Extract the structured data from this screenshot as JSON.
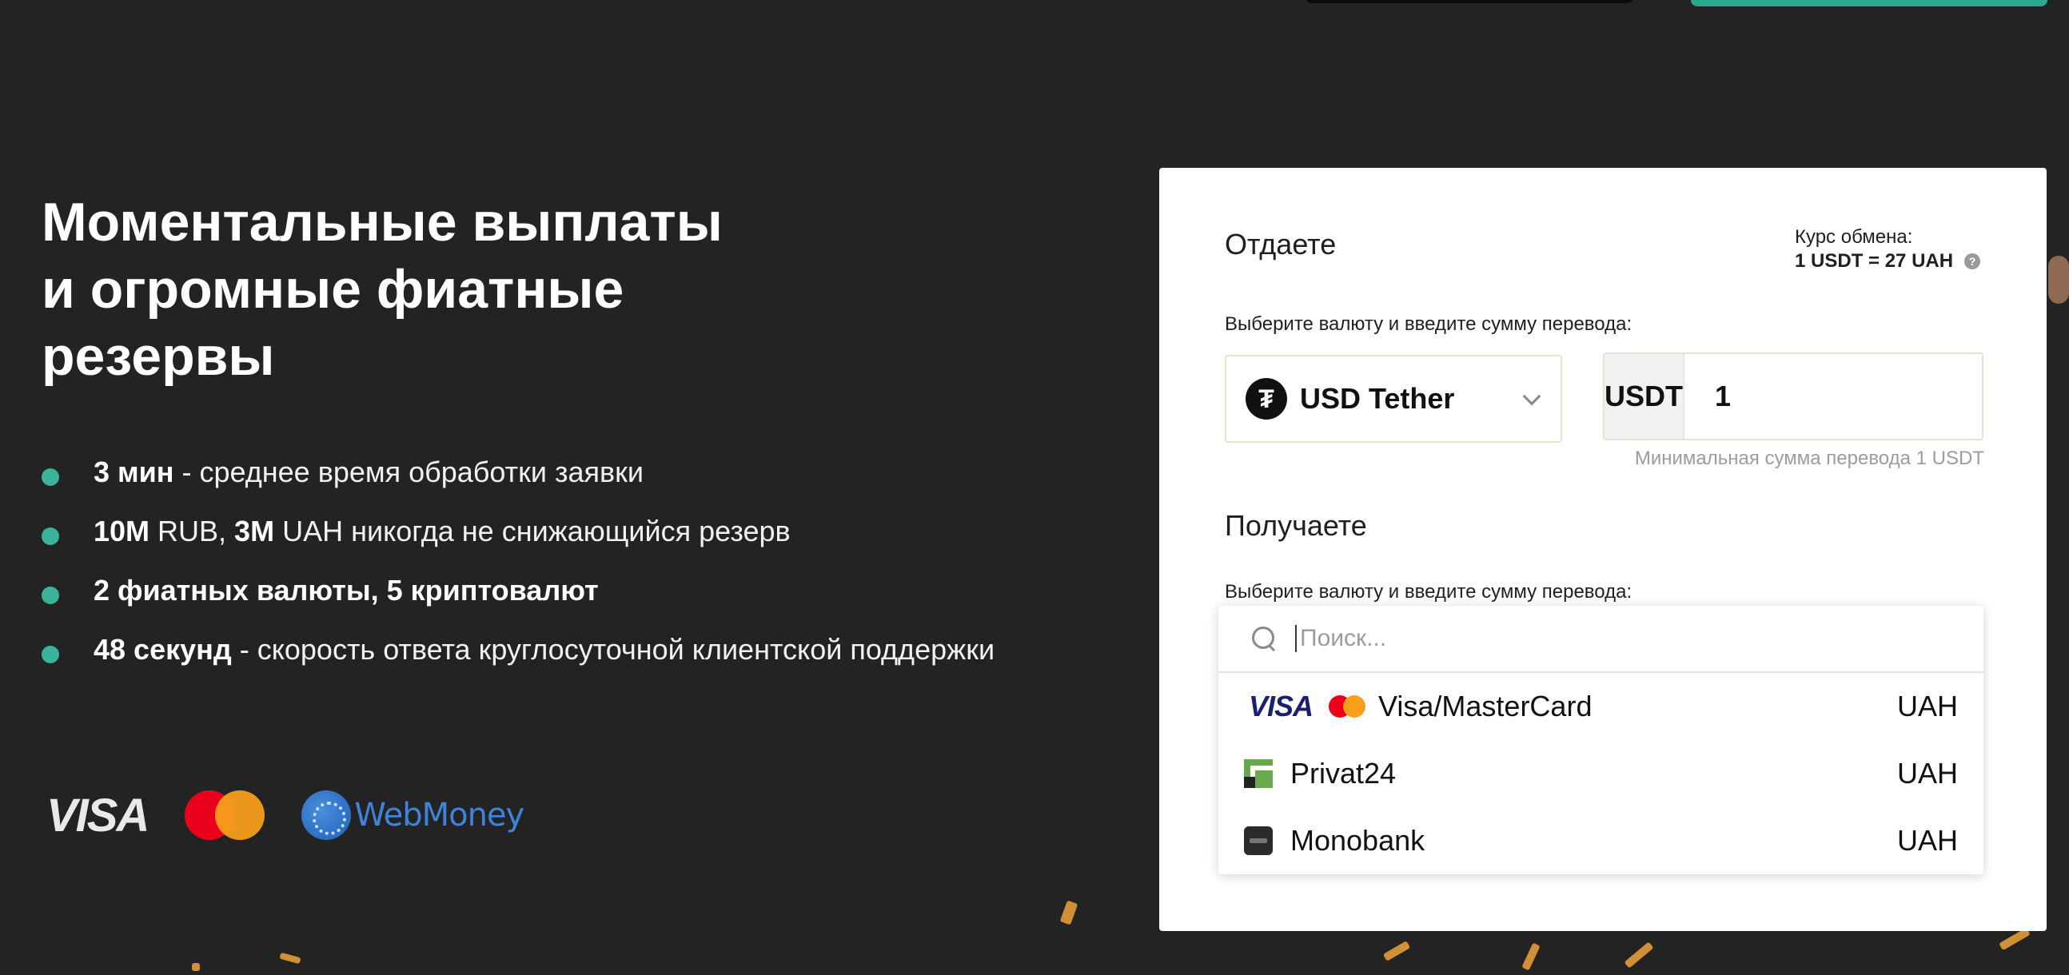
{
  "hero": {
    "title_lines": [
      "Моментальные выплаты",
      "и огромные фиатные",
      "резервы"
    ]
  },
  "features": [
    {
      "bold": "3 мин",
      "text": " - среднее время обработки заявки"
    },
    {
      "bold": "10M",
      "text": " RUB, ",
      "bold2": "3M",
      "text2": " UAH никогда не снижающийся резерв"
    },
    {
      "bold": "2 фиатных валюты, 5 криптовалют",
      "text": ""
    },
    {
      "bold": "48 секунд",
      "text": " - скорость ответа круглосуточной клиентской поддержки"
    }
  ],
  "payment_logos": {
    "visa": "VISA",
    "webmoney": "WebMoney"
  },
  "exchange": {
    "give_title": "Отдаете",
    "rate_label": "Курс обмена:",
    "rate_value": "1 USDT = 27 UAH",
    "give_hint": "Выберите валюту и введите сумму перевода:",
    "give_currency": "USD Tether",
    "give_code": "USDT",
    "give_amount": "1",
    "min_note": "Минимальная сумма перевода 1 USDT",
    "receive_title": "Получаете",
    "receive_hint": "Выберите валюту и введите сумму перевода:",
    "search_placeholder": "Поиск...",
    "options": [
      {
        "label": "Visa/MasterCard",
        "currency": "UAH",
        "icon": "visa-mastercard-icon"
      },
      {
        "label": "Privat24",
        "currency": "UAH",
        "icon": "privat24-icon"
      },
      {
        "label": "Monobank",
        "currency": "UAH",
        "icon": "monobank-icon"
      }
    ]
  },
  "colors": {
    "background": "#232323",
    "accent_teal": "#3bb39a",
    "card": "#ffffff"
  }
}
